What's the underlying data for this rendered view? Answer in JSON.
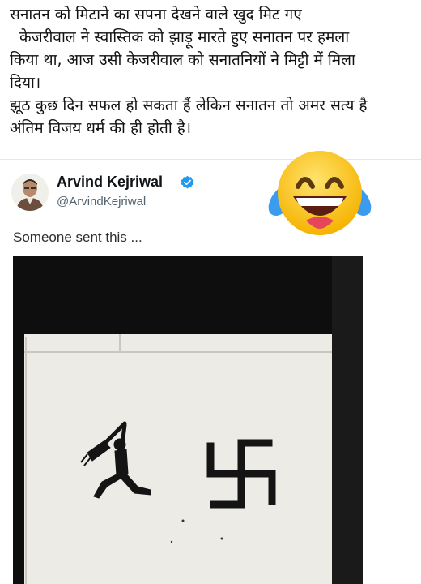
{
  "post": {
    "caption_lines": [
      "सनातन को मिटाने का सपना देखने वाले खुद मिट गए",
      "केजरीवाल ने स्वास्तिक को झाड़ू मारते हुए सनातन पर हमला",
      "किया था, आज उसी केजरीवाल को सनातनियों ने मिट्टी में मिला",
      "दिया।",
      "झूठ कुछ दिन सफल हो सकता हैं लेकिन सनातन तो अमर सत्य है",
      "अंतिम विजय धर्म की ही होती है।"
    ],
    "reaction_emoji": "laughing-with-tears-emoji"
  },
  "tweet": {
    "author_name": "Arvind Kejriwal",
    "author_handle": "@ArvindKejriwal",
    "verified_icon": "verified-badge-icon",
    "text": "Someone sent this ...",
    "photo_description_icon": "broom-figure-and-swastika-graffiti"
  },
  "colors": {
    "verified_blue": "#1d9bf0",
    "emoji_yellow": "#ffc933",
    "emoji_tears": "#3a9bef",
    "handle_gray": "#536471"
  }
}
